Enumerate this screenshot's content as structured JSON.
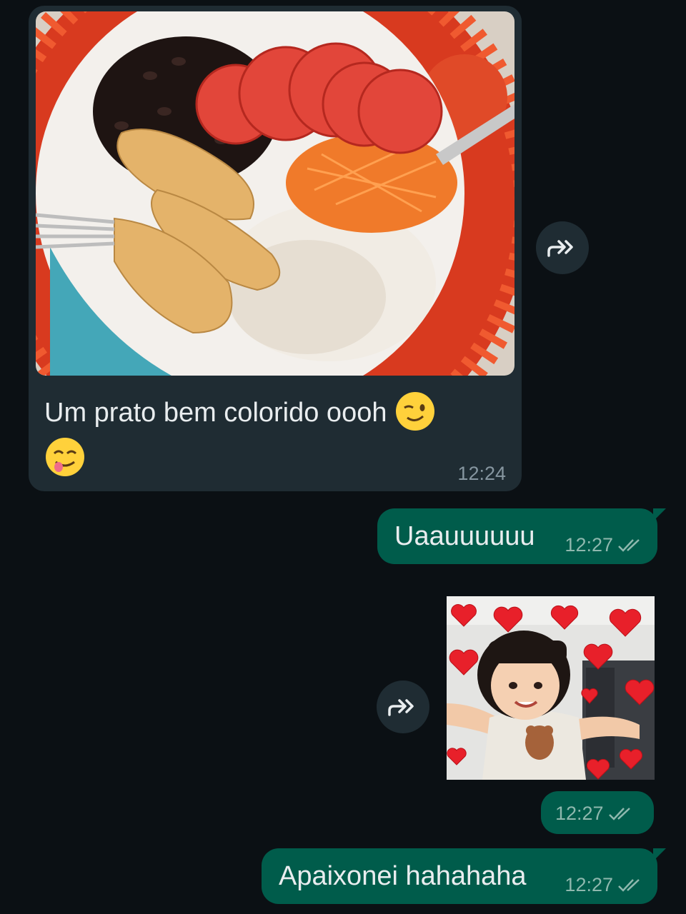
{
  "messages": {
    "incoming": {
      "caption": "Um prato bem colorido oooh",
      "emoji_1": "winking-face",
      "emoji_2": "face-savoring-food",
      "time": "12:24",
      "image": "photo-plate-chicken-beans-rice-carrot-tomato"
    },
    "outgoing_1": {
      "text": "Uaauuuuuu",
      "time": "12:27",
      "status": "read-double-check"
    },
    "outgoing_2": {
      "image": "photo-girl-with-hearts",
      "time": "12:27",
      "status": "read-double-check"
    },
    "outgoing_3": {
      "text": "Apaixonei hahahaha",
      "time": "12:27",
      "status": "read-double-check"
    }
  },
  "icons": {
    "forward": "forward-icon",
    "ticks": "double-check-icon"
  },
  "colors": {
    "background": "#0b1014",
    "incoming_bubble": "#1f2c33",
    "outgoing_bubble": "#005c4b",
    "timestamp": "#8696a0"
  }
}
